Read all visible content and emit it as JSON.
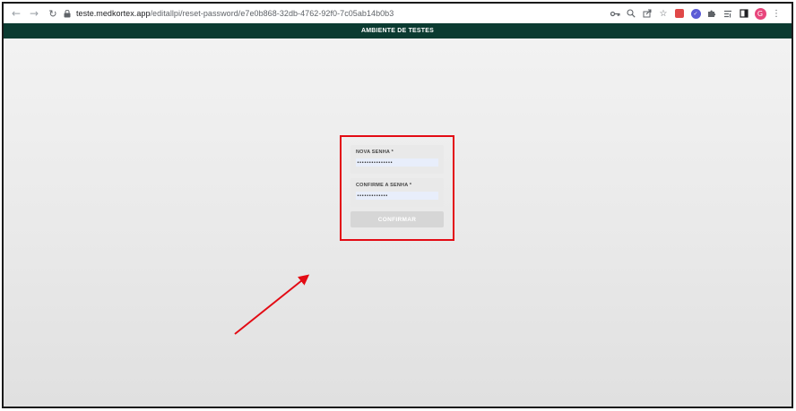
{
  "browser": {
    "url_host": "teste.medkortex.app",
    "url_path": "/editallpi/reset-password/e7e0b868-32db-4762-92f0-7c05ab14b0b3",
    "avatar_letter": "G",
    "icons": [
      "back-icon",
      "forward-icon",
      "reload-icon",
      "lock-icon",
      "key-icon",
      "zoom-icon",
      "share-icon",
      "star-icon",
      "extension-red-icon",
      "extension-purple-icon",
      "puzzle-icon",
      "reading-list-icon",
      "side-panel-icon",
      "profile-avatar",
      "menu-icon"
    ]
  },
  "banner": {
    "text": "AMBIENTE DE TESTES"
  },
  "form": {
    "new_password_label": "NOVA SENHA *",
    "new_password_value": "•••••••••••••••",
    "confirm_password_label": "CONFIRME A SENHA *",
    "confirm_password_value": "•••••••••••••",
    "confirm_button": "CONFIRMAR"
  },
  "colors": {
    "banner": "#0b3b31",
    "highlight": "#e30b14",
    "arrow": "#e30b14"
  }
}
